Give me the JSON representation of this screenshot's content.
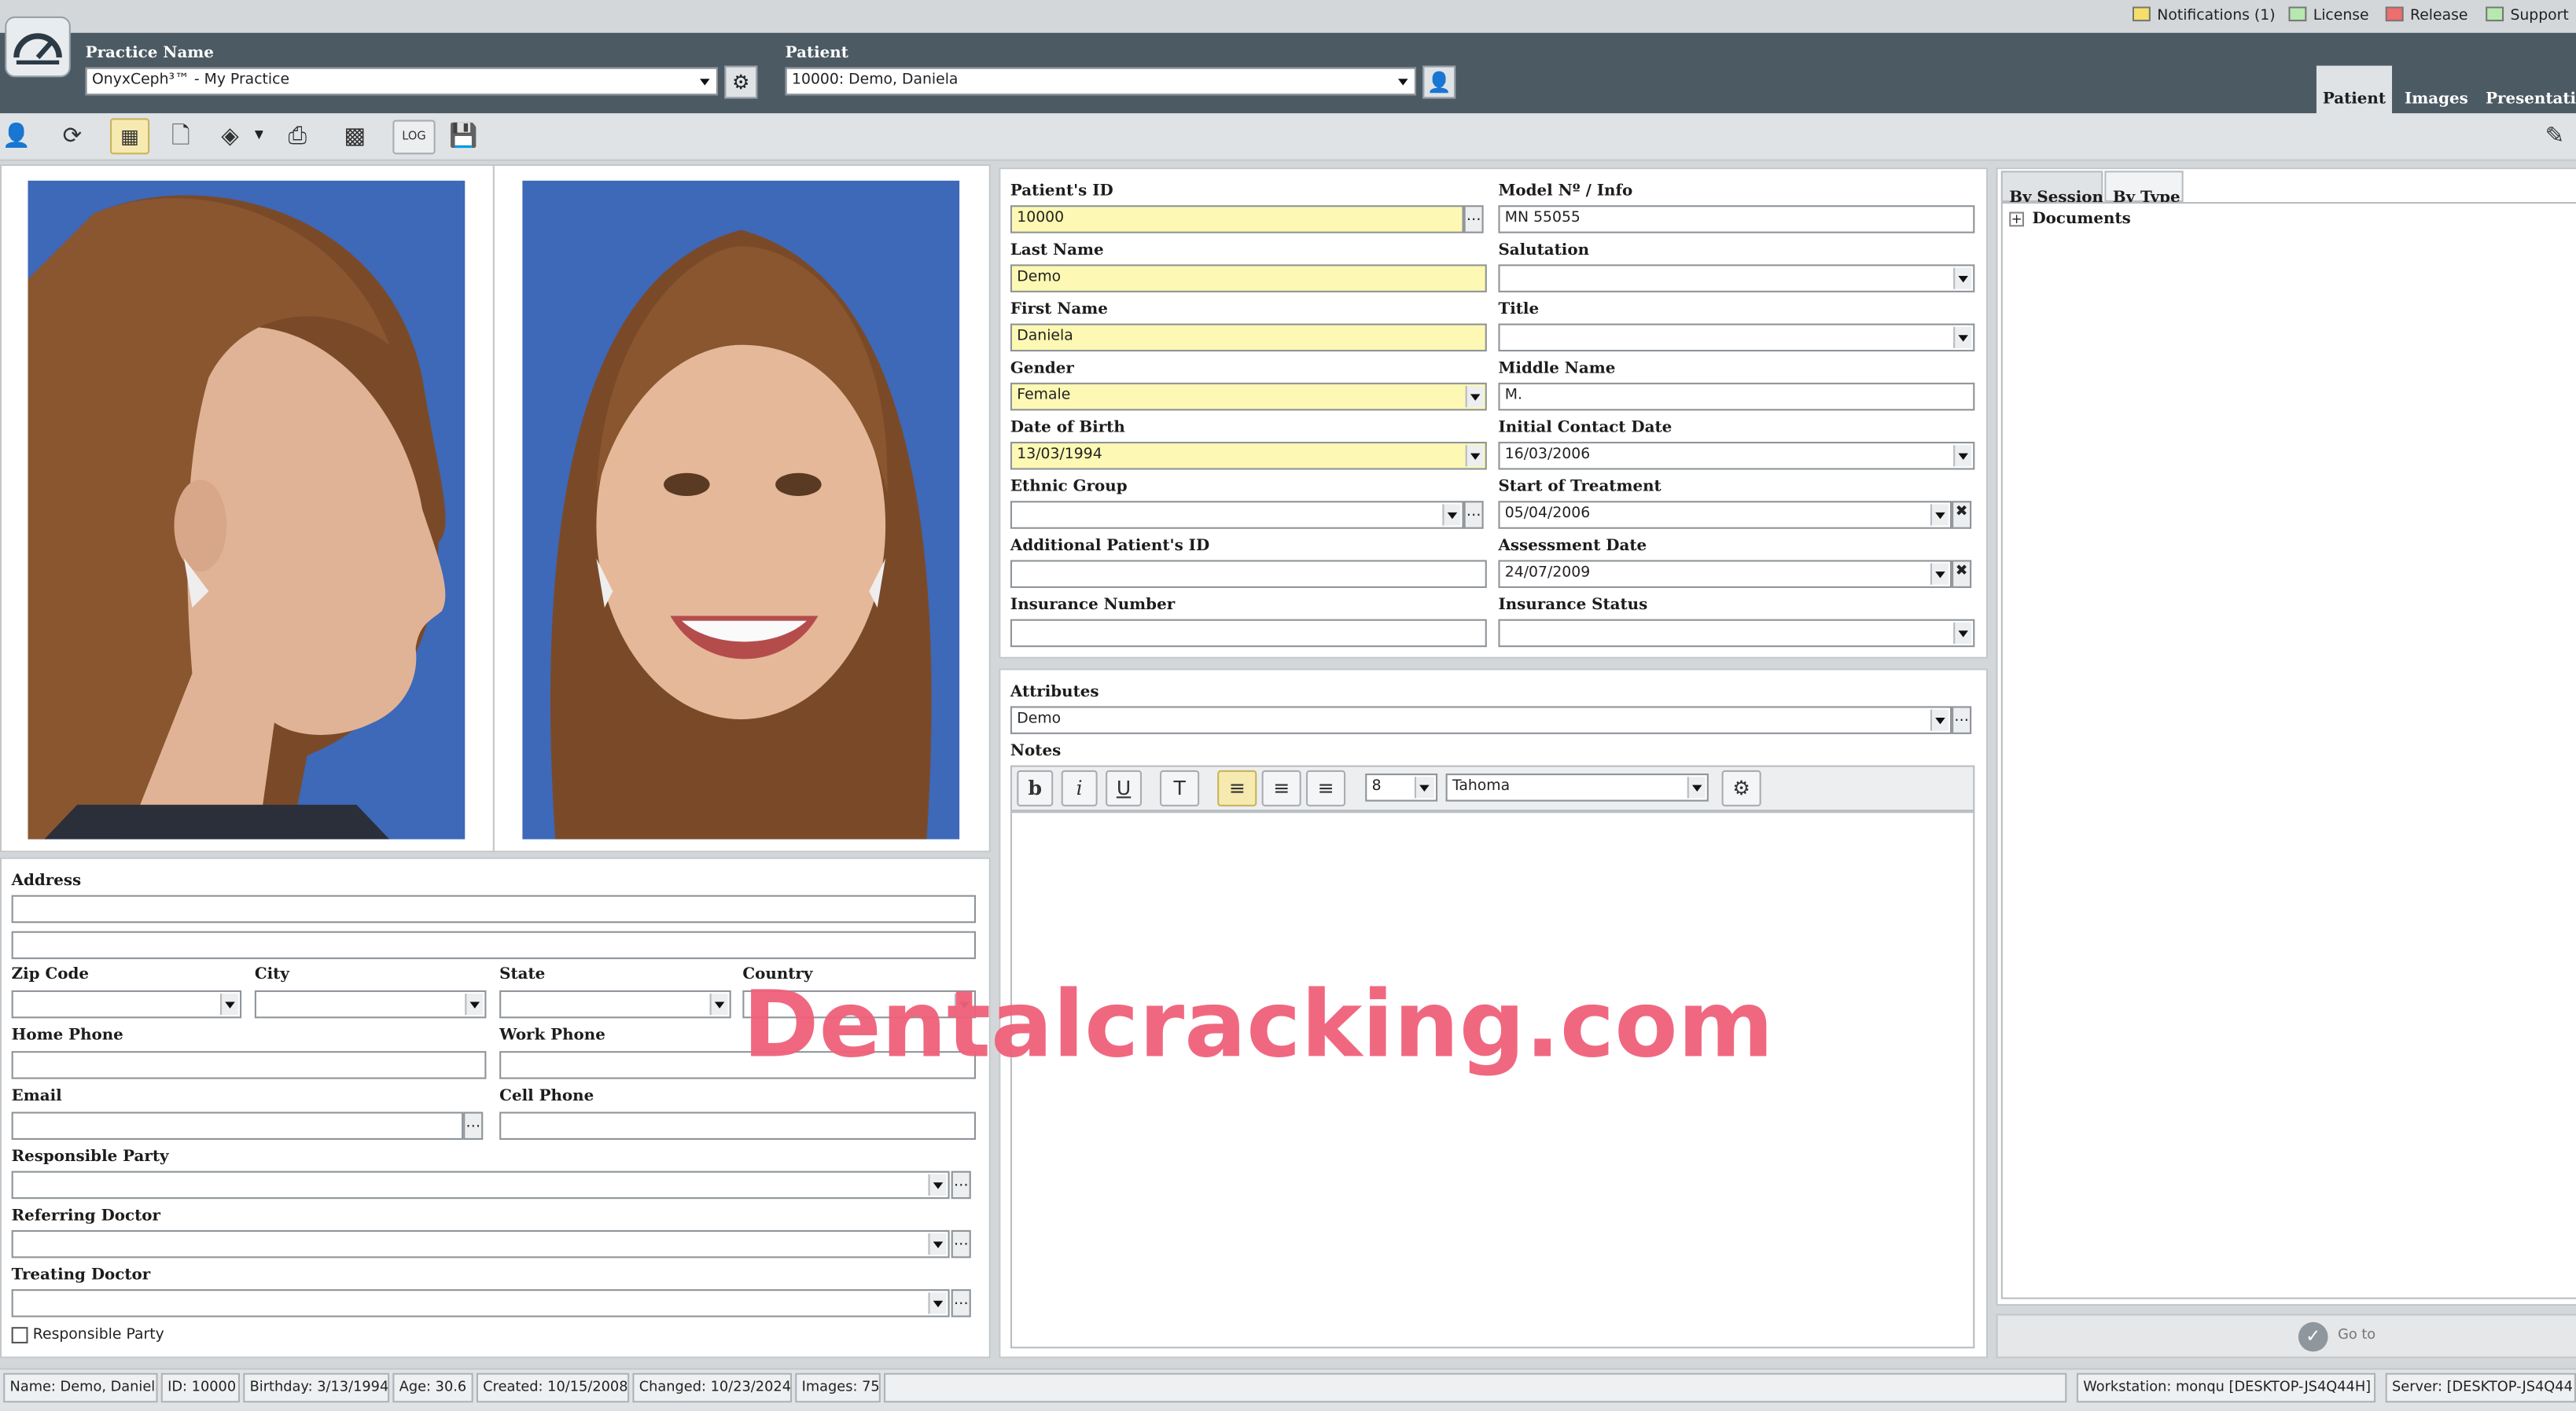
{
  "top_links": [
    {
      "label": "Notifications (1)",
      "color": "#f5df6a"
    },
    {
      "label": "License",
      "color": "#b6e8b0"
    },
    {
      "label": "Release",
      "color": "#ee6d6d"
    },
    {
      "label": "Support",
      "color": "#b6e8b0"
    }
  ],
  "header": {
    "practice_label": "Practice Name",
    "practice_value": "OnyxCeph³™ - My Practice",
    "patient_label": "Patient",
    "patient_value": "10000: Demo, Daniela",
    "tabs": [
      "Patient",
      "Images",
      "Presentatio"
    ]
  },
  "toolbar": {
    "log_label": "LOG"
  },
  "form": {
    "patient_id": {
      "label": "Patient's ID",
      "value": "10000"
    },
    "model_no": {
      "label": "Model Nº / Info",
      "value": "MN 55055"
    },
    "last_name": {
      "label": "Last Name",
      "value": "Demo"
    },
    "salutation": {
      "label": "Salutation",
      "value": ""
    },
    "first_name": {
      "label": "First Name",
      "value": "Daniela"
    },
    "title": {
      "label": "Title",
      "value": ""
    },
    "gender": {
      "label": "Gender",
      "value": "Female"
    },
    "middle_name": {
      "label": "Middle Name",
      "value": "M."
    },
    "dob": {
      "label": "Date of Birth",
      "value": "13/03/1994"
    },
    "initial_contact": {
      "label": "Initial Contact Date",
      "value": "16/03/2006"
    },
    "ethnic_group": {
      "label": "Ethnic Group",
      "value": ""
    },
    "start_treatment": {
      "label": "Start of Treatment",
      "value": "05/04/2006"
    },
    "additional_id": {
      "label": "Additional Patient's ID",
      "value": ""
    },
    "assessment_date": {
      "label": "Assessment Date",
      "value": "24/07/2009"
    },
    "insurance_number": {
      "label": "Insurance Number",
      "value": ""
    },
    "insurance_status": {
      "label": "Insurance Status",
      "value": ""
    }
  },
  "attributes": {
    "label": "Attributes",
    "value": "Demo",
    "notes_label": "Notes",
    "font_size": "8",
    "font_name": "Tahoma"
  },
  "address": {
    "address_label": "Address",
    "zip_label": "Zip Code",
    "city_label": "City",
    "state_label": "State",
    "country_label": "Country",
    "home_phone_label": "Home Phone",
    "work_phone_label": "Work Phone",
    "email_label": "Email",
    "cell_phone_label": "Cell Phone",
    "responsible_party_label": "Responsible Party",
    "referring_doctor_label": "Referring Doctor",
    "treating_doctor_label": "Treating Doctor",
    "responsible_checkbox_label": "Responsible Party"
  },
  "documents": {
    "tabs": [
      "By Session",
      "By Type"
    ],
    "tree_root": "Documents",
    "goto_label": "Go to"
  },
  "watermark": "Dentalcracking.com",
  "status": {
    "name": "Name: Demo, Daniela",
    "id": "ID: 10000",
    "birthday": "Birthday: 3/13/1994",
    "age": "Age: 30.6",
    "created": "Created: 10/15/2008",
    "changed": "Changed: 10/23/2024",
    "images": "Images: 75",
    "workstation": "Workstation: monqu [DESKTOP-JS4Q44H]",
    "server": "Server: [DESKTOP-JS4Q44"
  },
  "colors": {
    "header": "#4c5a64",
    "required": "#fdf8b3",
    "watermark": "#f0607a",
    "active_tab": "#dfe3e6"
  }
}
